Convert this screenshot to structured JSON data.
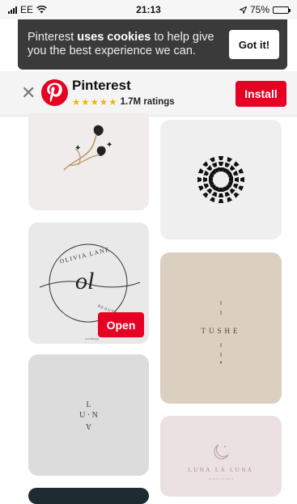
{
  "status_bar": {
    "carrier": "EE",
    "time": "21:13",
    "battery": "75%",
    "battery_level": 0.75
  },
  "cookie_banner": {
    "message_pre": "Pinterest ",
    "message_bold": "uses cookies",
    "message_post": " to help give you the best experience we can.",
    "button": "Got it!"
  },
  "app_banner": {
    "app_name": "Pinterest",
    "stars": "★★★★★",
    "ratings": "1.7M ratings",
    "install": "Install"
  },
  "pins": {
    "open_label": "Open",
    "olivia_top": "OLIVIA LANE",
    "olivia_mono": "ol",
    "olivia_sub": "BEAUTY & CO.",
    "olivia_credit": "oviedesign",
    "tushe": "TUSHE",
    "luna_1": "L",
    "luna_2": "U · N",
    "luna_3": "A",
    "luna_la_luna": "LUNA LA LUNA",
    "luna_la_luna_sub": "JEWELLERY"
  },
  "colors": {
    "accent": "#e60023",
    "cookie_bg": "#3a3a3a"
  }
}
